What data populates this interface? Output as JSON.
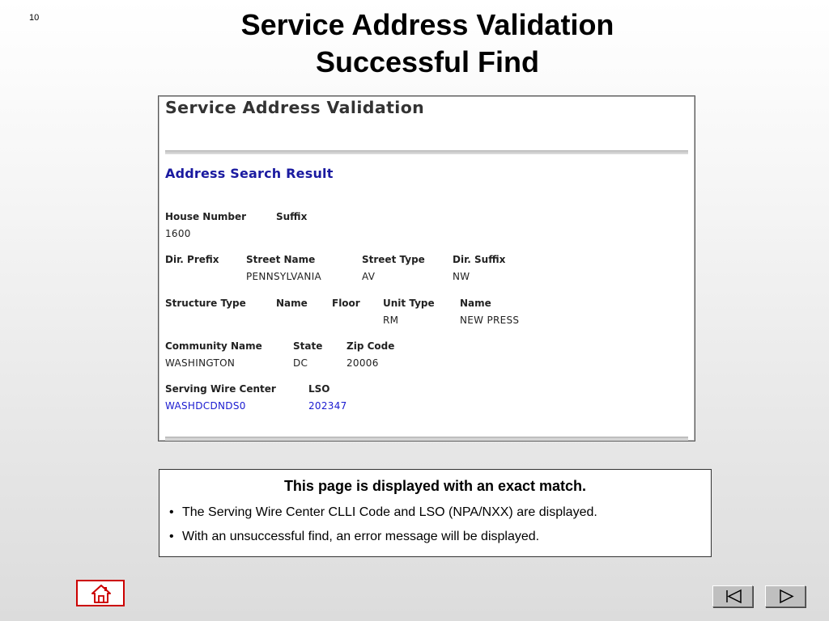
{
  "slide": {
    "page_number": "10",
    "title_line_1": "Service Address Validation",
    "title_line_2": "Successful Find"
  },
  "screenshot": {
    "app_title": "Service Address Validation",
    "section_title": "Address Search Result",
    "row1": {
      "labels": [
        "House Number",
        "Suffix"
      ],
      "values": [
        "1600",
        ""
      ]
    },
    "row2": {
      "labels": [
        "Dir. Prefix",
        "Street Name",
        "Street Type",
        "Dir. Suffix"
      ],
      "values": [
        "",
        "PENNSYLVANIA",
        "AV",
        "NW"
      ]
    },
    "row3": {
      "labels": [
        "Structure Type",
        "Name",
        "Floor",
        "Unit Type",
        "Name"
      ],
      "values": [
        "",
        "",
        "",
        "RM",
        "NEW PRESS"
      ]
    },
    "row4": {
      "labels": [
        "Community Name",
        "State",
        "Zip Code"
      ],
      "values": [
        "WASHINGTON",
        "DC",
        "20006"
      ]
    },
    "row5": {
      "labels": [
        "Serving Wire Center",
        "LSO"
      ],
      "values": [
        "WASHDCDNDS0",
        "202347"
      ]
    },
    "value_link_color": "#1a1ad0",
    "section_title_color": "#1a1aa0"
  },
  "note": {
    "heading": "This page is displayed with an exact match.",
    "bullets": [
      "The Serving Wire Center CLLI Code and LSO (NPA/NXX) are displayed.",
      "With an unsuccessful find,  an error message will be displayed."
    ]
  },
  "navigation": {
    "home_icon": "home-icon",
    "prev_icon": "skip-back-icon",
    "next_icon": "play-forward-icon",
    "home_border_color": "#cc0000"
  }
}
